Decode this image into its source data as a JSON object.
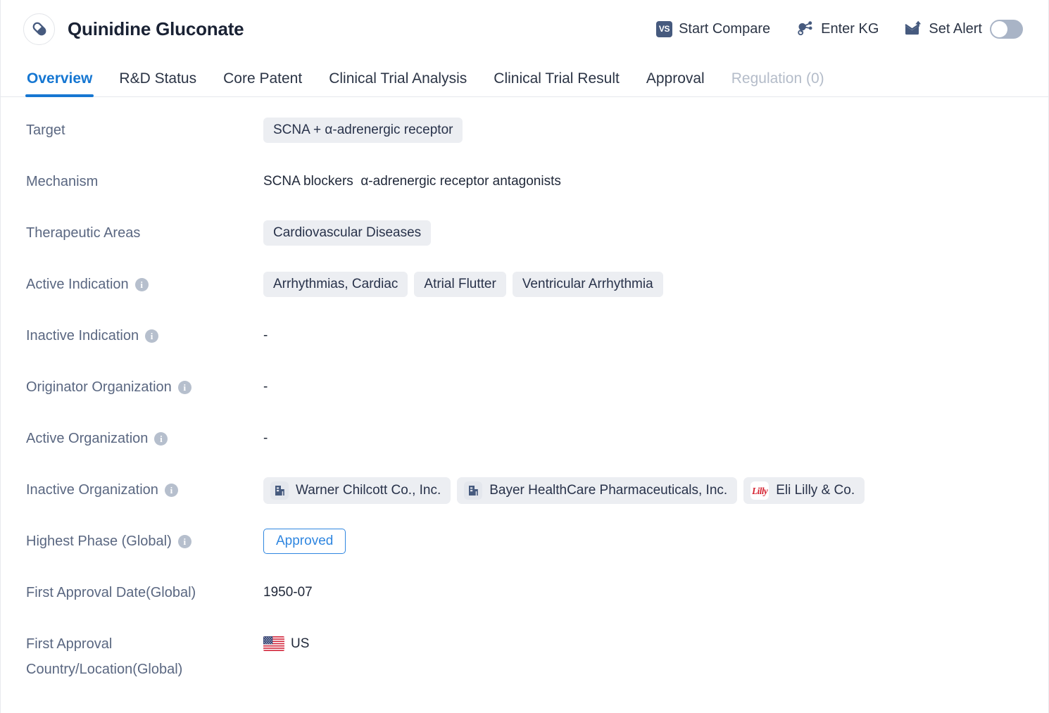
{
  "header": {
    "drug_name": "Quinidine Gluconate",
    "avatar_icon": "capsule-pill-icon",
    "actions": [
      {
        "id": "start-compare",
        "label": "Start Compare",
        "icon": "vs-badge-icon",
        "badge_text": "VS"
      },
      {
        "id": "enter-kg",
        "label": "Enter KG",
        "icon": "knowledge-graph-icon"
      },
      {
        "id": "set-alert",
        "label": "Set Alert",
        "icon": "alert-mail-icon"
      }
    ],
    "alert_toggle": {
      "state": "off"
    }
  },
  "tabs": [
    {
      "label": "Overview",
      "state": "active"
    },
    {
      "label": "R&D Status",
      "state": "normal"
    },
    {
      "label": "Core Patent",
      "state": "normal"
    },
    {
      "label": "Clinical Trial Analysis",
      "state": "normal"
    },
    {
      "label": "Clinical Trial Result",
      "state": "normal"
    },
    {
      "label": "Approval",
      "state": "normal"
    },
    {
      "label": "Regulation (0)",
      "state": "disabled"
    }
  ],
  "overview": {
    "target": {
      "label": "Target",
      "chips": [
        "SCNA + α-adrenergic receptor"
      ]
    },
    "mechanism": {
      "label": "Mechanism",
      "value": "SCNA blockers  α-adrenergic receptor antagonists"
    },
    "therapeutic_areas": {
      "label": "Therapeutic Areas",
      "chips": [
        "Cardiovascular Diseases"
      ]
    },
    "active_indication": {
      "label": "Active Indication",
      "has_info": true,
      "chips": [
        "Arrhythmias, Cardiac",
        "Atrial Flutter",
        "Ventricular Arrhythmia"
      ]
    },
    "inactive_indication": {
      "label": "Inactive Indication",
      "has_info": true,
      "value": "-"
    },
    "originator_organization": {
      "label": "Originator Organization",
      "has_info": true,
      "value": "-"
    },
    "active_organization": {
      "label": "Active Organization",
      "has_info": true,
      "value": "-"
    },
    "inactive_organization": {
      "label": "Inactive Organization",
      "has_info": true,
      "orgs": [
        {
          "name": "Warner Chilcott Co., Inc.",
          "logo": "building-icon"
        },
        {
          "name": "Bayer HealthCare Pharmaceuticals, Inc.",
          "logo": "building-icon"
        },
        {
          "name": "Eli Lilly & Co.",
          "logo": "lilly-logo",
          "logo_text": "Lilly"
        }
      ]
    },
    "highest_phase": {
      "label": "Highest Phase (Global)",
      "has_info": true,
      "value": "Approved"
    },
    "first_approval_date": {
      "label": "First Approval Date(Global)",
      "value": "1950-07"
    },
    "first_approval_country": {
      "label": "First Approval\nCountry/Location(Global)",
      "country_code": "US",
      "flag": "us-flag-icon"
    }
  },
  "colors": {
    "accent_blue": "#1677d2",
    "phase_blue": "#2f86e0",
    "label_gray": "#5a6781",
    "chip_bg": "#eceef2",
    "title_navy": "#1a2234",
    "disabled_gray": "#b4bcc9",
    "lilly_red": "#d5202f"
  }
}
